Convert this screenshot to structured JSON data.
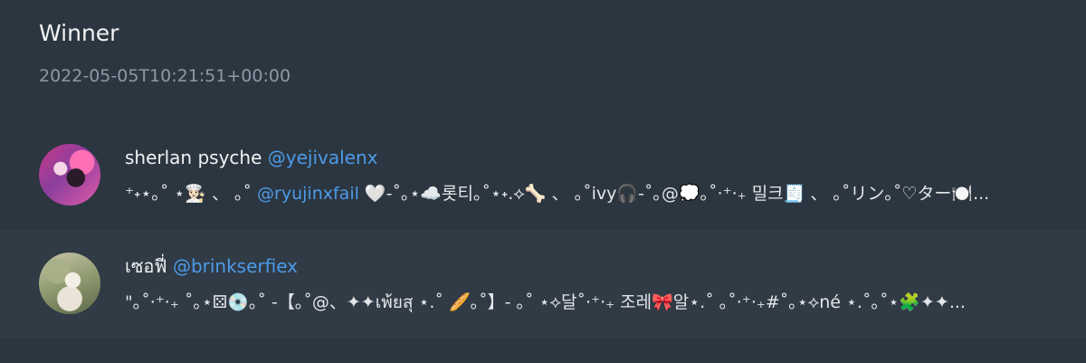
{
  "header": {
    "title": "Winner",
    "timestamp": "2022-05-05T10:21:51+00:00"
  },
  "entries": [
    {
      "display_name": "sherlan psyche",
      "handle": "@yejivalenx",
      "message_before": "⁺˖⋆｡˚ ⋆👩🏻‍🍳 、 ｡˚ ",
      "message_mention": "@ryujinxfail",
      "message_after": " 🤍-˚｡⋆☁️롯티｡˚⋆˖.⟡🦴 、 ｡˚ivy🎧-˚｡@💭｡˚·⁺‧₊ 밀크🧾 、 ｡˚リン｡˚♡ター🍽️..."
    },
    {
      "display_name": "เซอฟี่",
      "handle": "@brinkserfiex",
      "message_before": "",
      "message_mention": "",
      "message_after": "\"｡˚·⁺‧₊ ˚｡⋆⚄💿｡˚ -【｡˚@、✦✦เพ้ยสุ ⋆.˚ 🥖｡˚】- ｡˚ ⋆⟡달˚·⁺‧₊ 조레🎀알⋆.˚ ｡˚·⁺‧₊#˚｡⋆⟡né ⋆.˚｡˚⋆🧩✦✦..."
    }
  ]
}
